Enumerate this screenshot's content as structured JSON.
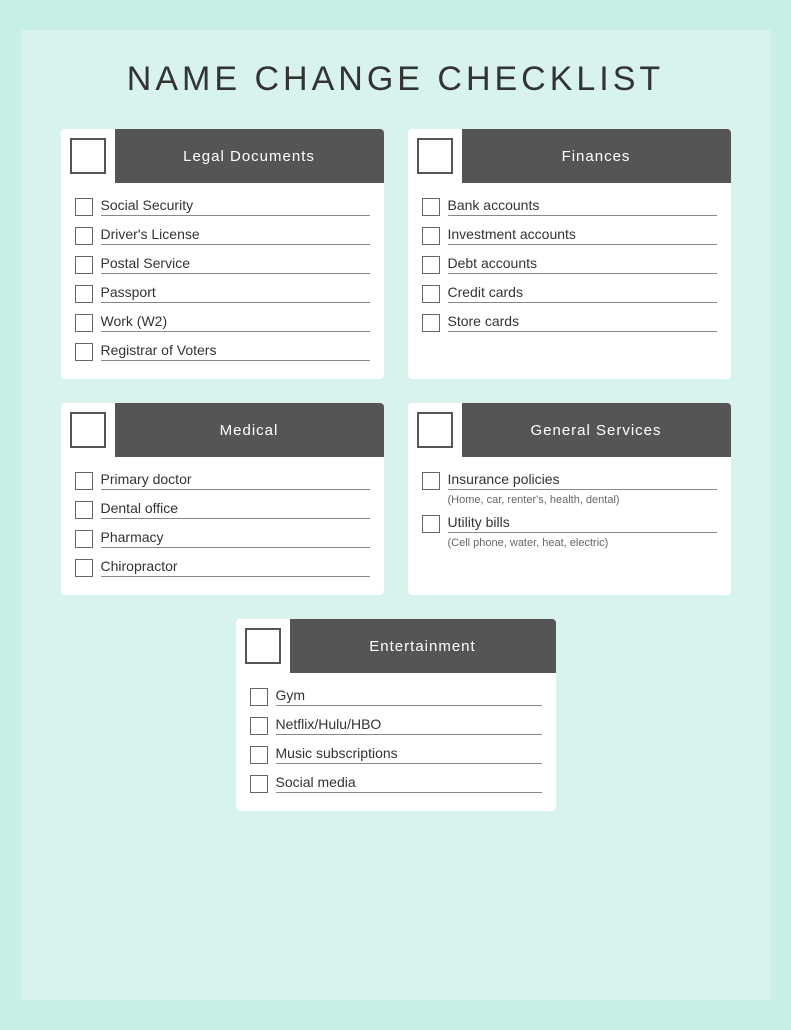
{
  "page": {
    "title": "NAME CHANGE CHECKLIST",
    "sections": [
      {
        "id": "legal",
        "title": "Legal Documents",
        "items": [
          "Social Security",
          "Driver's License",
          "Postal Service",
          "Passport",
          "Work (W2)",
          "Registrar of Voters"
        ]
      },
      {
        "id": "finances",
        "title": "Finances",
        "items": [
          "Bank accounts",
          "Investment accounts",
          "Debt accounts",
          "Credit cards",
          "Store cards"
        ]
      },
      {
        "id": "medical",
        "title": "Medical",
        "items": [
          "Primary doctor",
          "Dental office",
          "Pharmacy",
          "Chiropractor"
        ]
      },
      {
        "id": "general",
        "title": "General Services",
        "items_special": [
          {
            "label": "Insurance policies",
            "sublabel": "(Home, car, renter's, health, dental)"
          },
          {
            "label": "Utility bills",
            "sublabel": "(Cell phone, water, heat, electric)"
          }
        ]
      }
    ],
    "entertainment": {
      "title": "Entertainment",
      "items": [
        "Gym",
        "Netflix/Hulu/HBO",
        "Music subscriptions",
        "Social media"
      ]
    }
  }
}
